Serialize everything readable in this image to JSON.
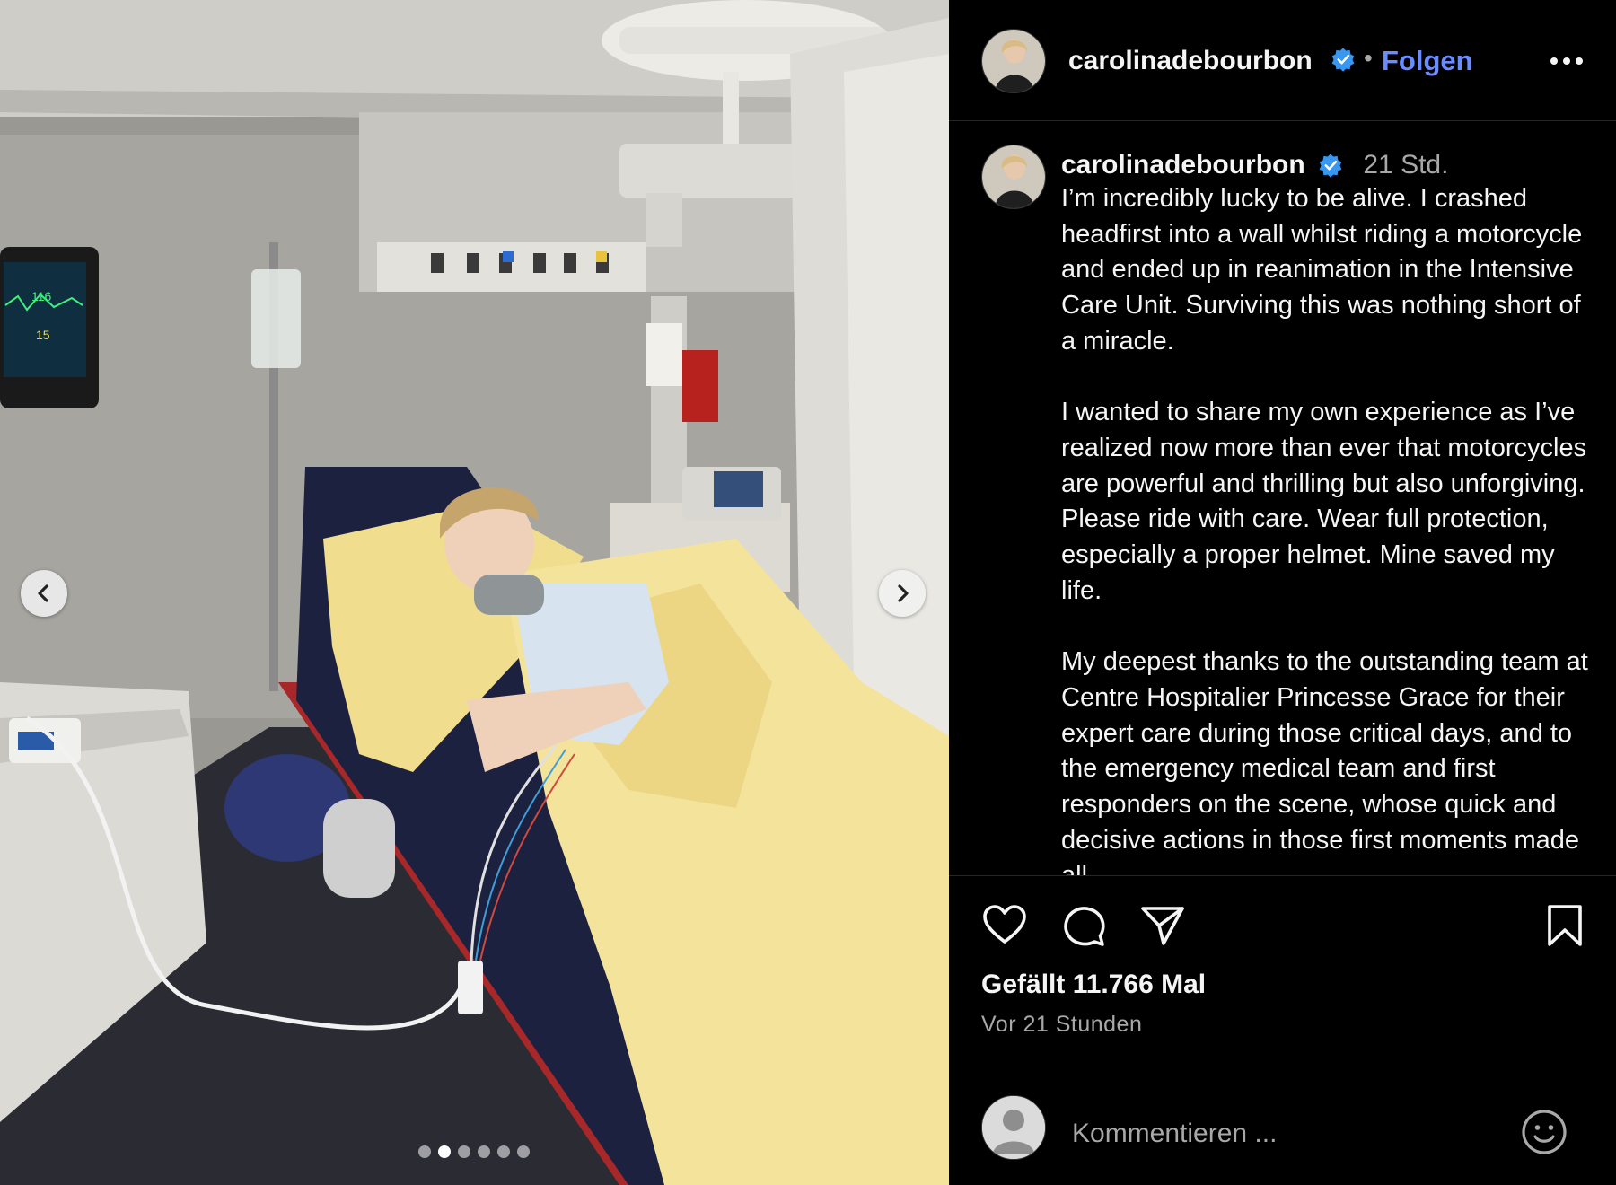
{
  "post": {
    "username": "carolinadebourbon",
    "follow_label": "Folgen",
    "separator": "•",
    "time_short": "21 Std.",
    "caption_paragraphs": [
      "I’m incredibly lucky to be alive. I crashed headfirst into a wall whilst riding a motorcycle and ended up in reanimation in the Intensive Care Unit. Surviving this was nothing short of a miracle.",
      "I wanted to share my own experience as I’ve realized now more than ever that motorcycles are powerful and thrilling but also unforgiving. Please ride with care. Wear full protection, especially a proper helmet. Mine saved my life.",
      "My deepest thanks to the outstanding team at Centre Hospitalier Princesse Grace for their expert care during those critical days, and to the emergency medical team and first responders on the scene, whose quick and decisive actions in those first moments made all"
    ],
    "likes_text": "Gefällt 11.766 Mal",
    "time_long": "Vor 21 Stunden"
  },
  "carousel": {
    "slide_count": 6,
    "active_slide": 2
  },
  "comment": {
    "placeholder": "Kommentieren ..."
  },
  "colors": {
    "follow": "#6b8cff",
    "verified": "#3897f0",
    "background": "#000000",
    "muted_text": "#a8a8a8"
  },
  "icons": [
    "chevron-left-icon",
    "chevron-right-icon",
    "more-icon",
    "verified-badge-icon",
    "heart-icon",
    "comment-icon",
    "share-icon",
    "bookmark-icon",
    "emoji-icon",
    "avatar-icon"
  ]
}
